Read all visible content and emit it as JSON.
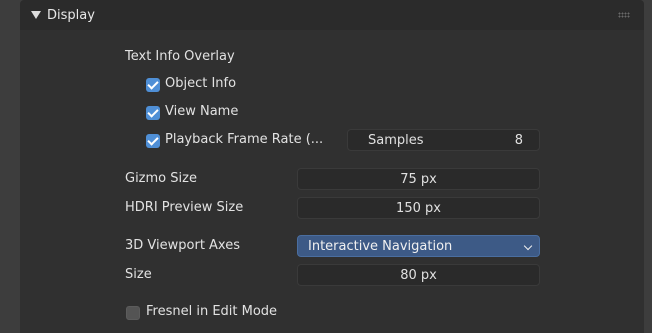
{
  "panel": {
    "title": "Display"
  },
  "text_info": {
    "heading": "Text Info Overlay",
    "object_info": {
      "label": "Object Info",
      "checked": true
    },
    "view_name": {
      "label": "View Name",
      "checked": true
    },
    "playback_frame_rate": {
      "label": "Playback Frame Rate (...",
      "checked": true
    },
    "samples": {
      "label": "Samples",
      "value": "8"
    }
  },
  "gizmo_size": {
    "label": "Gizmo Size",
    "value": "75 px"
  },
  "hdri_preview_size": {
    "label": "HDRI Preview Size",
    "value": "150 px"
  },
  "viewport_axes": {
    "label": "3D Viewport Axes",
    "value": "Interactive Navigation"
  },
  "axes_size": {
    "label": "Size",
    "value": "80 px"
  },
  "fresnel": {
    "label": "Fresnel in Edit Mode",
    "checked": false
  },
  "colors": {
    "accent": "#4f8fd6",
    "dropdown": "#3d5a86",
    "panel_bg": "#303030",
    "header_bg": "#2b2b2b"
  },
  "icons": {
    "collapse": "triangle-down-icon",
    "drag": "drag-grip-icon",
    "dropdown": "chevron-down-icon",
    "check": "checkmark-icon"
  }
}
